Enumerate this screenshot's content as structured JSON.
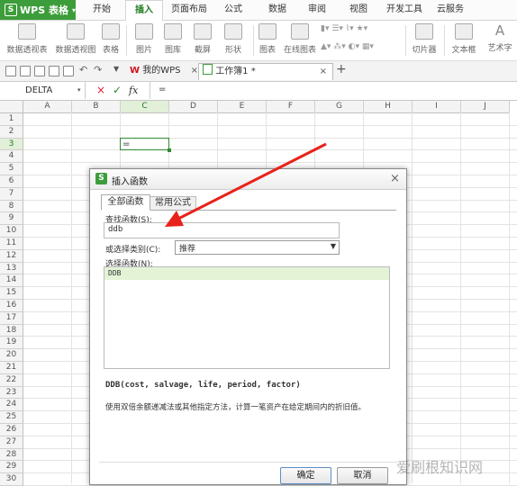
{
  "app": {
    "name": "WPS 表格",
    "logo": "S"
  },
  "menu": {
    "tabs": [
      "开始",
      "插入",
      "页面布局",
      "公式",
      "数据",
      "审阅",
      "视图",
      "开发工具",
      "云服务"
    ],
    "active": "插入"
  },
  "ribbon": {
    "pivot_table": "数据透视表",
    "pivot_chart": "数据透视图",
    "table": "表格",
    "picture": "图片",
    "gallery": "图库",
    "screenshot": "截屏",
    "shape": "形状",
    "chart": "图表",
    "online_chart": "在线图表",
    "slicer": "切片器",
    "textbox": "文本框",
    "wordart": "艺术字"
  },
  "doc_tabs": {
    "home": "我的WPS",
    "workbook": "工作簿1 *",
    "close": "×",
    "add": "+"
  },
  "formula_bar": {
    "name_box": "DELTA",
    "cancel": "×",
    "confirm": "✓",
    "fx": "fx",
    "content": "="
  },
  "grid": {
    "columns": [
      "A",
      "B",
      "C",
      "D",
      "E",
      "F",
      "G",
      "H",
      "I",
      "J"
    ],
    "rows": [
      "1",
      "2",
      "3",
      "4",
      "5",
      "6",
      "7",
      "8",
      "9",
      "10",
      "11",
      "12",
      "13",
      "14",
      "15",
      "16",
      "17",
      "18",
      "19",
      "20",
      "21",
      "22",
      "23",
      "24",
      "25",
      "26",
      "27",
      "28",
      "29",
      "30"
    ],
    "active_cell_value": "=",
    "active_column": "C",
    "active_row": "3"
  },
  "dialog": {
    "icon": "S",
    "title": "插入函数",
    "close": "×",
    "tabs": [
      "全部函数",
      "常用公式"
    ],
    "search_label": "查找函数(S):",
    "search_value": "ddb",
    "category_label": "或选择类别(C):",
    "category_value": "推荐",
    "select_label": "选择函数(N):",
    "functions": [
      "DDB"
    ],
    "signature": "DDB(cost, salvage, life, period, factor)",
    "description": "使用双倍余额递减法或其他指定方法，计算一笔资产在给定期间内的折旧值。",
    "ok": "确定",
    "cancel": "取消"
  },
  "watermark": "爱刷根知识网",
  "colors": {
    "accent": "#3d9d3a",
    "arrow": "#e8221a",
    "selection": "#e4f3d6"
  }
}
